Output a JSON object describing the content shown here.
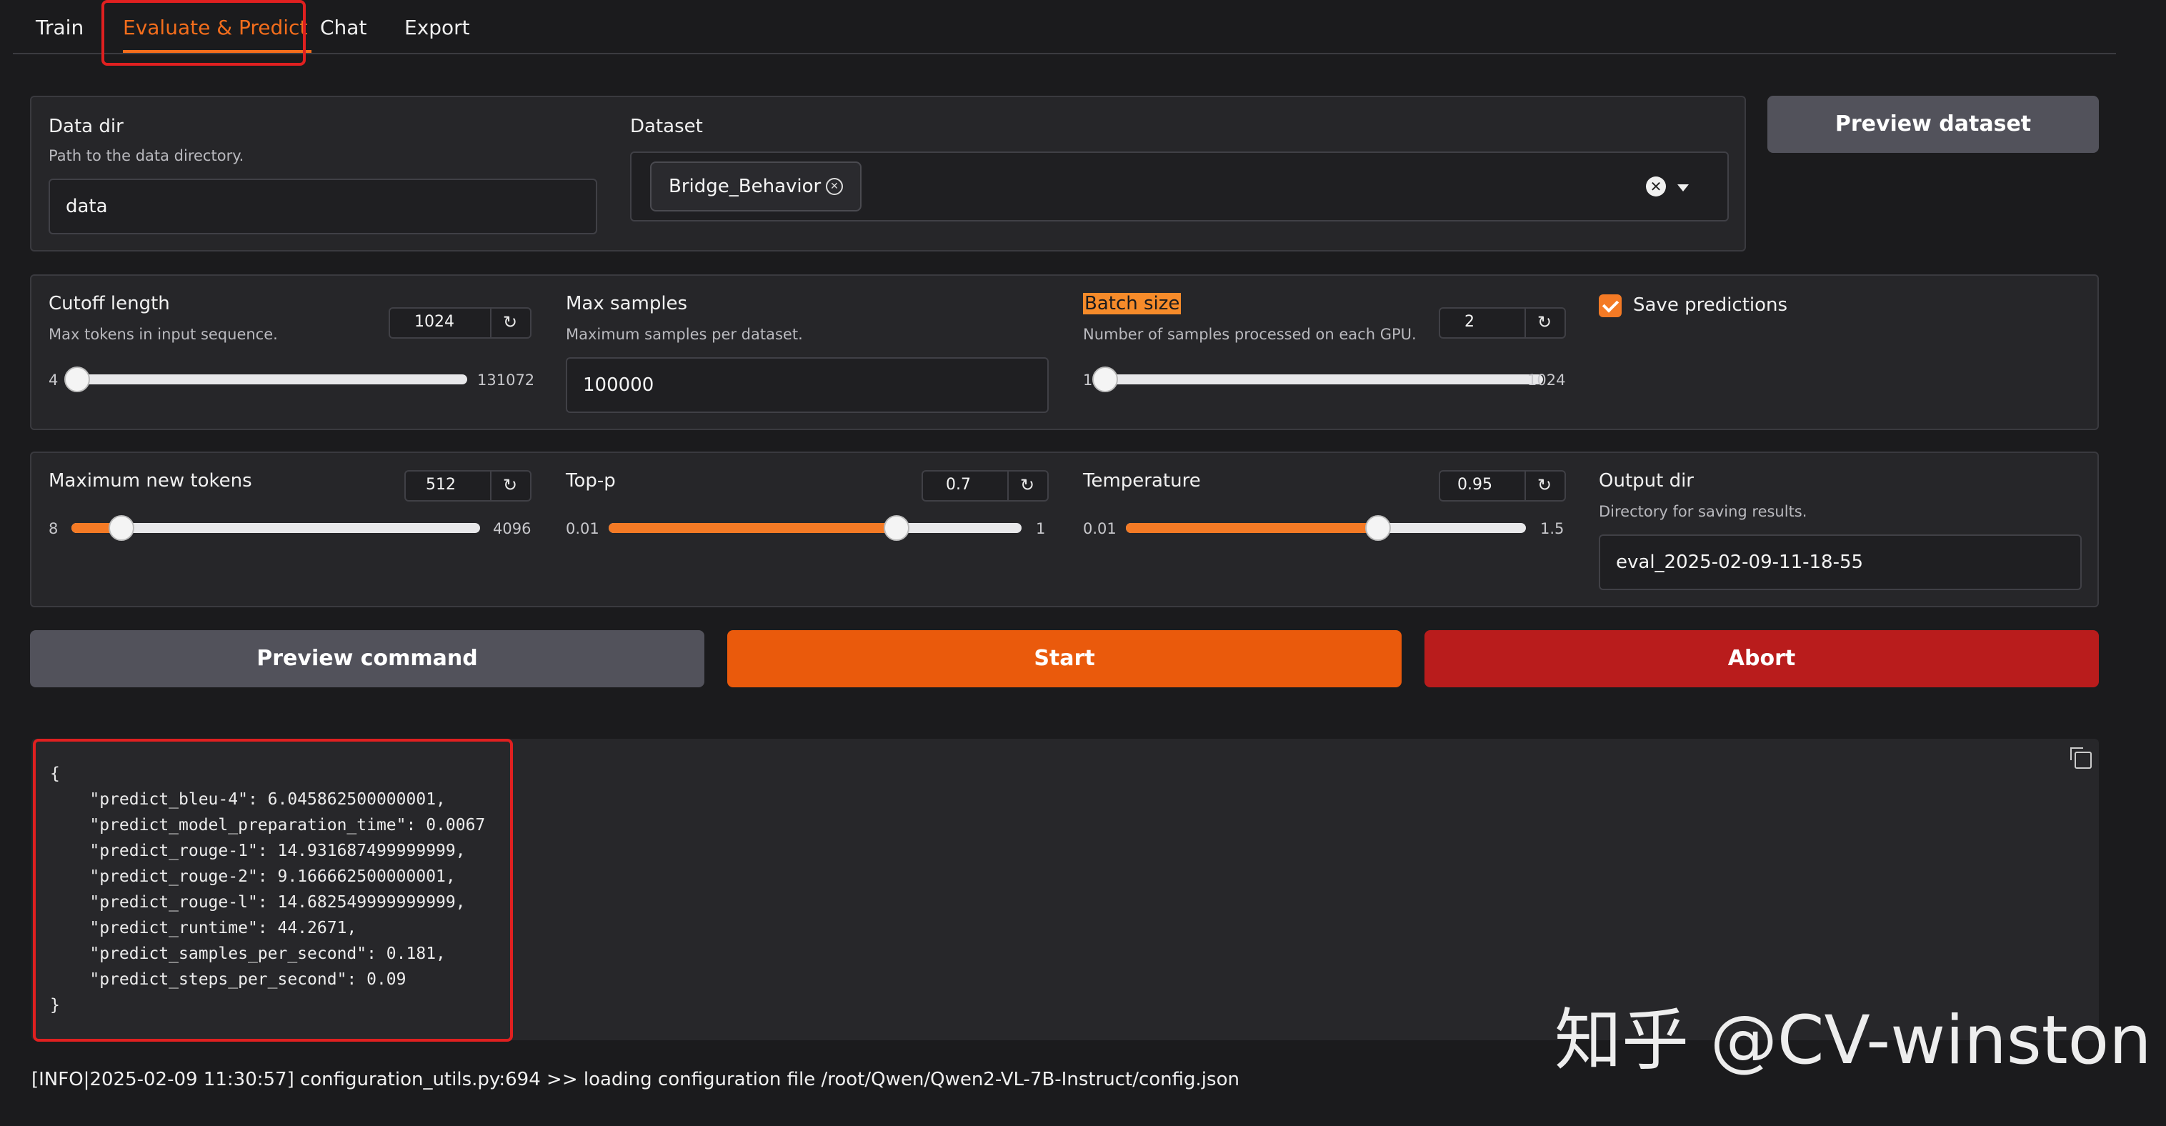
{
  "tabs": [
    "Train",
    "Evaluate & Predict",
    "Chat",
    "Export"
  ],
  "active_tab": "Evaluate & Predict",
  "data_dir": {
    "label": "Data dir",
    "help": "Path to the data directory.",
    "value": "data"
  },
  "dataset": {
    "label": "Dataset",
    "selected": "Bridge_Behavior"
  },
  "preview_dataset_label": "Preview dataset",
  "cutoff_length": {
    "label": "Cutoff length",
    "help": "Max tokens in input sequence.",
    "value": "1024",
    "min": "4",
    "max": "131072",
    "fraction": 0.0078
  },
  "max_samples": {
    "label": "Max samples",
    "help": "Maximum samples per dataset.",
    "value": "100000"
  },
  "batch_size": {
    "label": "Batch size",
    "help": "Number of samples processed on each GPU.",
    "value": "2",
    "min": "1",
    "max": "1024",
    "fraction": 0.001
  },
  "save_predictions": {
    "label": "Save predictions",
    "checked": true
  },
  "max_new_tokens": {
    "label": "Maximum new tokens",
    "value": "512",
    "min": "8",
    "max": "4096",
    "fraction": 0.123
  },
  "top_p": {
    "label": "Top-p",
    "value": "0.7",
    "min": "0.01",
    "max": "1",
    "fraction": 0.697
  },
  "temperature": {
    "label": "Temperature",
    "value": "0.95",
    "min": "0.01",
    "max": "1.5",
    "fraction": 0.631
  },
  "output_dir": {
    "label": "Output dir",
    "help": "Directory for saving results.",
    "value": "eval_2025-02-09-11-18-55"
  },
  "buttons": {
    "preview_command": "Preview command",
    "start": "Start",
    "abort": "Abort"
  },
  "output_lines": [
    "{",
    "    \"predict_bleu-4\": 6.045862500000001,",
    "    \"predict_model_preparation_time\": 0.0067",
    "    \"predict_rouge-1\": 14.931687499999999,",
    "    \"predict_rouge-2\": 9.166662500000001,",
    "    \"predict_rouge-l\": 14.682549999999999,",
    "    \"predict_runtime\": 44.2671,",
    "    \"predict_samples_per_second\": 0.181,",
    "    \"predict_steps_per_second\": 0.09",
    "}"
  ],
  "log_line": "[INFO|2025-02-09 11:30:57] configuration_utils.py:694 >> loading configuration file /root/Qwen/Qwen2-VL-7B-Instruct/config.json",
  "watermark": "知乎 @CV-winston",
  "colors": {
    "accent": "#f36d1c",
    "start": "#ea5a0c",
    "abort": "#b91c1c",
    "secondary_button": "#52525b",
    "annotation_box": "#e02020"
  },
  "icons": [
    "reset-icon",
    "close-icon",
    "chevron-down-icon",
    "copy-icon",
    "checkbox-checked-icon"
  ]
}
